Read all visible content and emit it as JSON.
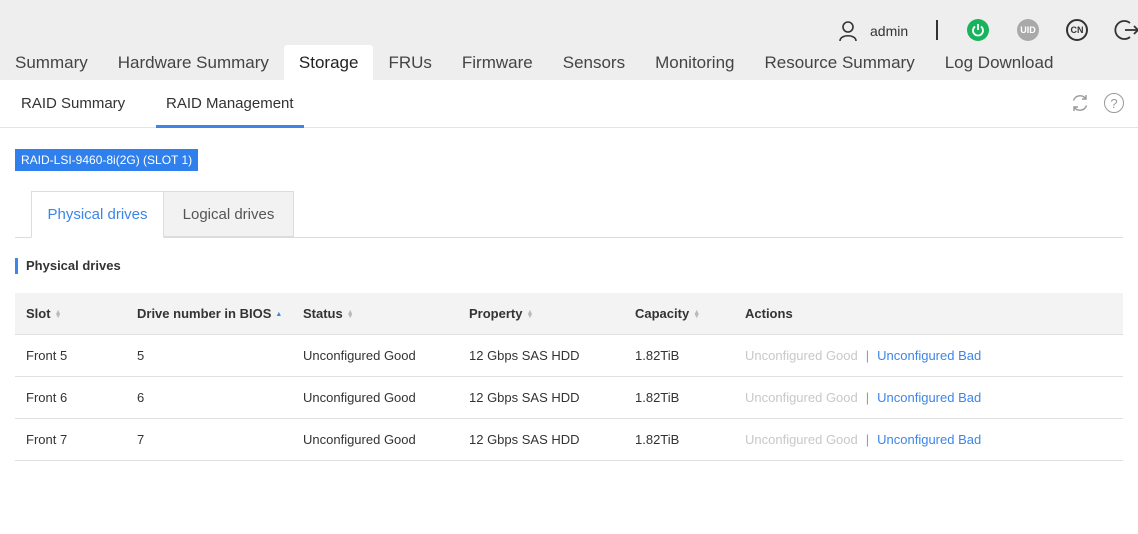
{
  "header": {
    "username": "admin",
    "uid_label": "UID",
    "lang_label": "CN",
    "colors": {
      "power": "#19b35e",
      "uid": "#a9a9a9",
      "accent": "#3b86e8"
    }
  },
  "main_tabs": [
    {
      "label": "Summary"
    },
    {
      "label": "Hardware Summary"
    },
    {
      "label": "Storage",
      "active": true
    },
    {
      "label": "FRUs"
    },
    {
      "label": "Firmware"
    },
    {
      "label": "Sensors"
    },
    {
      "label": "Monitoring"
    },
    {
      "label": "Resource Summary"
    },
    {
      "label": "Log Download"
    }
  ],
  "sub_tabs": [
    {
      "label": "RAID Summary"
    },
    {
      "label": "RAID Management",
      "active": true
    }
  ],
  "controller": {
    "label": "RAID-LSI-9460-8i(2G) (SLOT 1)"
  },
  "drive_tabs": [
    {
      "label": "Physical drives",
      "active": true
    },
    {
      "label": "Logical drives"
    }
  ],
  "section_title": "Physical drives",
  "table": {
    "columns": [
      {
        "label": "Slot",
        "sort": "none"
      },
      {
        "label": "Drive number in BIOS",
        "sort": "asc"
      },
      {
        "label": "Status",
        "sort": "none"
      },
      {
        "label": "Property",
        "sort": "none"
      },
      {
        "label": "Capacity",
        "sort": "none"
      },
      {
        "label": "Actions"
      }
    ],
    "rows": [
      {
        "slot": "Front 5",
        "bios": "5",
        "status": "Unconfigured Good",
        "property": "12 Gbps SAS HDD",
        "capacity": "1.82TiB",
        "action_disabled": "Unconfigured Good",
        "action_sep": "|",
        "action_link": "Unconfigured Bad"
      },
      {
        "slot": "Front 6",
        "bios": "6",
        "status": "Unconfigured Good",
        "property": "12 Gbps SAS HDD",
        "capacity": "1.82TiB",
        "action_disabled": "Unconfigured Good",
        "action_sep": "|",
        "action_link": "Unconfigured Bad"
      },
      {
        "slot": "Front 7",
        "bios": "7",
        "status": "Unconfigured Good",
        "property": "12 Gbps SAS HDD",
        "capacity": "1.82TiB",
        "action_disabled": "Unconfigured Good",
        "action_sep": "|",
        "action_link": "Unconfigured Bad"
      }
    ]
  }
}
